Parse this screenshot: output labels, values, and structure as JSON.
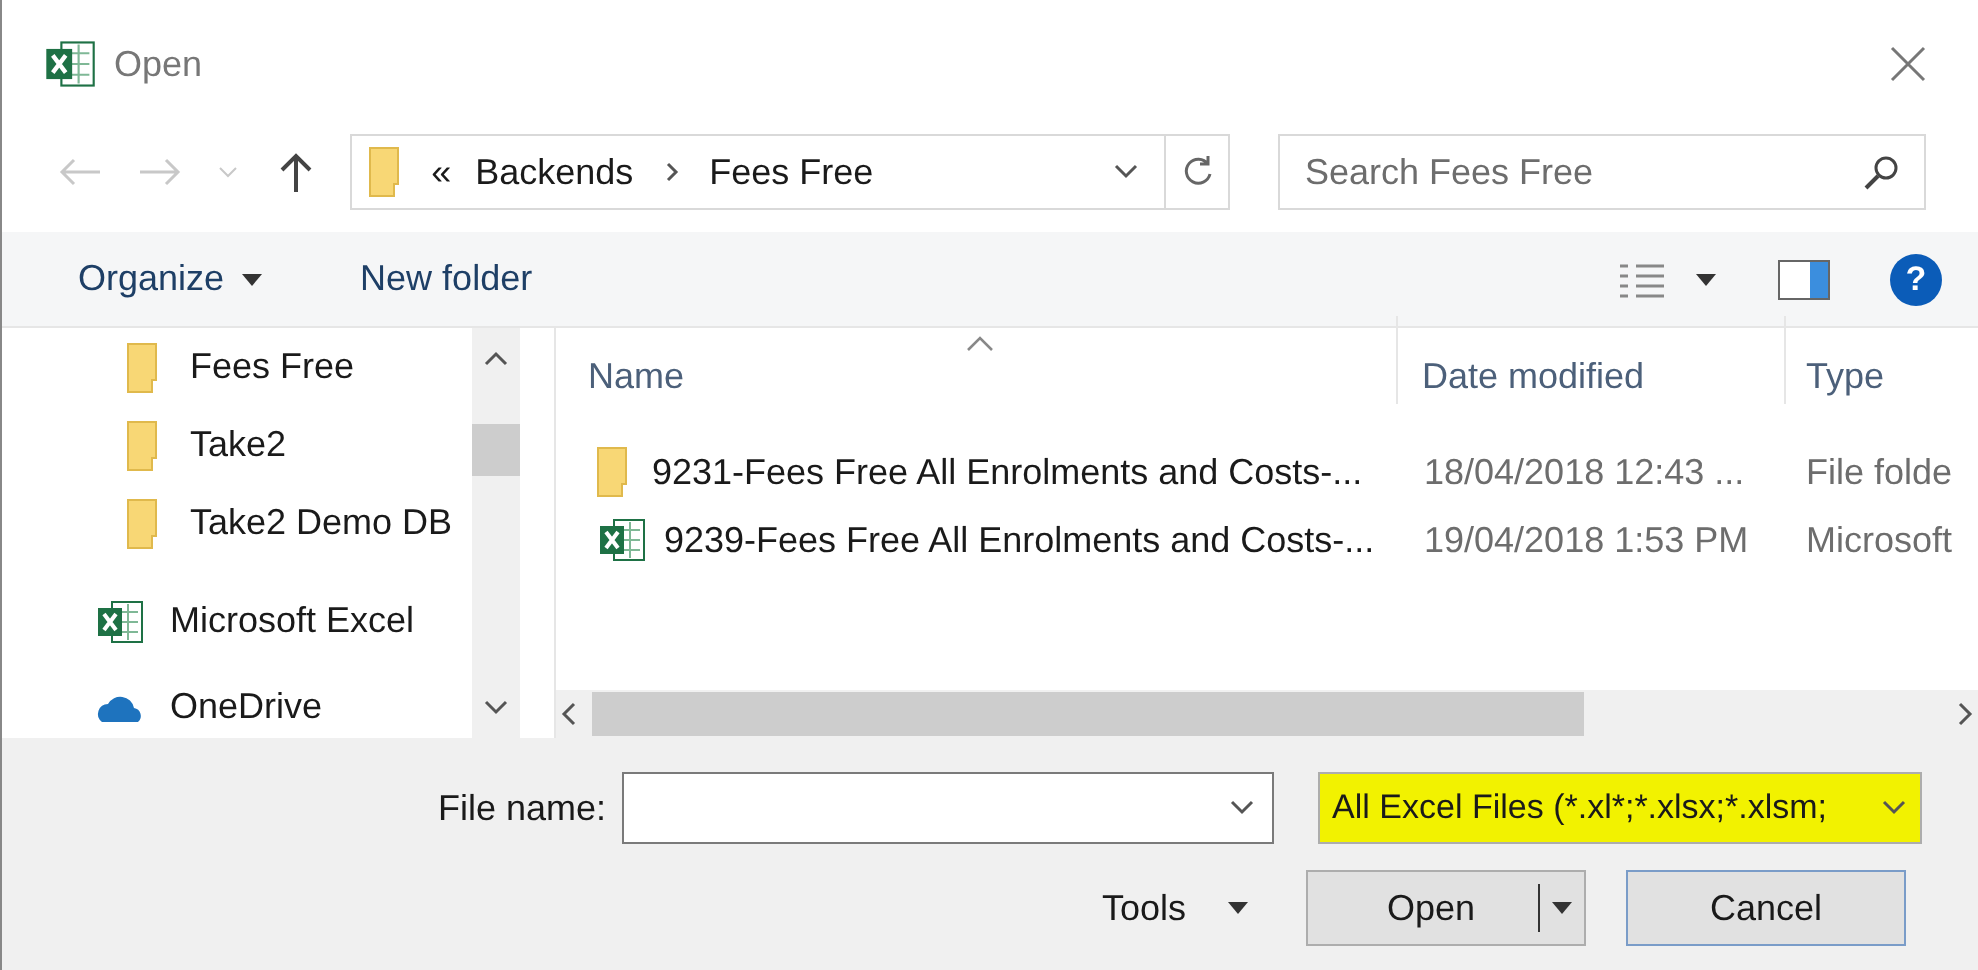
{
  "window": {
    "title": "Open"
  },
  "address": {
    "overflow": "«",
    "crumbs": [
      "Backends",
      "Fees Free"
    ]
  },
  "search": {
    "placeholder": "Search Fees Free"
  },
  "toolbar": {
    "organize": "Organize",
    "new_folder": "New folder"
  },
  "nav": {
    "items": [
      {
        "label": "Fees Free",
        "kind": "folder"
      },
      {
        "label": "Take2",
        "kind": "folder"
      },
      {
        "label": "Take2 Demo DB",
        "kind": "folder"
      },
      {
        "label": "Microsoft Excel",
        "kind": "excel"
      },
      {
        "label": "OneDrive",
        "kind": "cloud"
      }
    ]
  },
  "columns": [
    "Name",
    "Date modified",
    "Type"
  ],
  "files": [
    {
      "name": "9231-Fees Free All Enrolments and Costs-...",
      "date": "18/04/2018 12:43 ...",
      "type": "File folde",
      "kind": "folder"
    },
    {
      "name": "9239-Fees Free All Enrolments and Costs-...",
      "date": "19/04/2018 1:53 PM",
      "type": "Microsoft",
      "kind": "excel"
    }
  ],
  "file_name": {
    "label": "File name:"
  },
  "file_type": {
    "value": "All Excel Files (*.xl*;*.xlsx;*.xlsm;",
    "highlighted": true
  },
  "help": "?",
  "buttons": {
    "tools": "Tools",
    "open": "Open",
    "cancel": "Cancel"
  }
}
